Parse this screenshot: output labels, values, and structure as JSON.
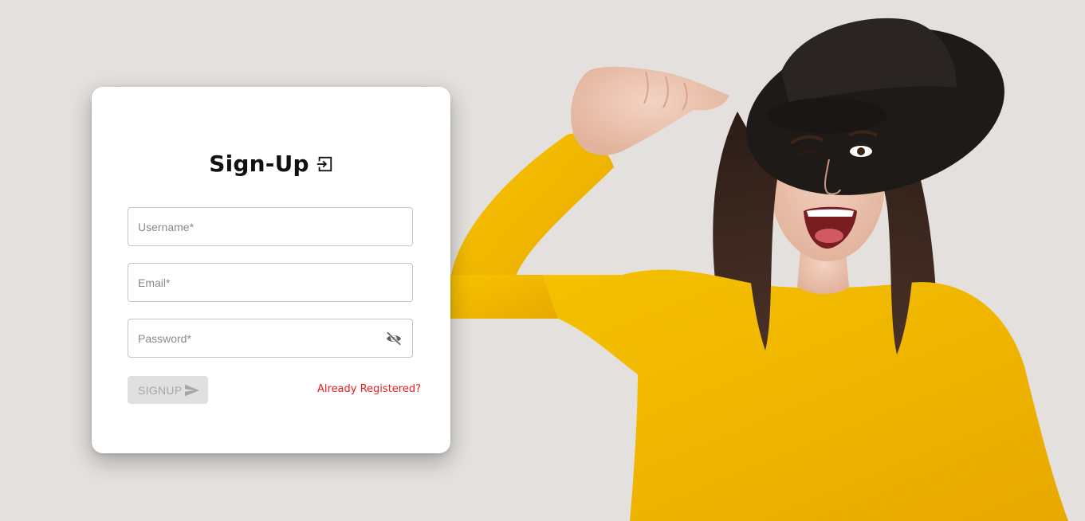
{
  "form": {
    "title": "Sign-Up",
    "title_icon": "login-icon",
    "username_placeholder": "Username*",
    "email_placeholder": "Email*",
    "password_placeholder": "Password*",
    "password_toggle_icon": "eye-off-icon",
    "signup_label": "SIGNUP",
    "signup_icon": "send-icon",
    "already_registered_label": "Already Registered?"
  },
  "colors": {
    "background": "#e3e0dd",
    "card": "#ffffff",
    "link": "#e81c1c",
    "button_disabled_bg": "#e0e0e0",
    "button_disabled_text": "#a6a6a6",
    "sweater": "#f5bd02",
    "hat": "#1e1a18"
  },
  "hero": {
    "image": "woman-in-yellow-sweater-and-black-hat-winking"
  }
}
